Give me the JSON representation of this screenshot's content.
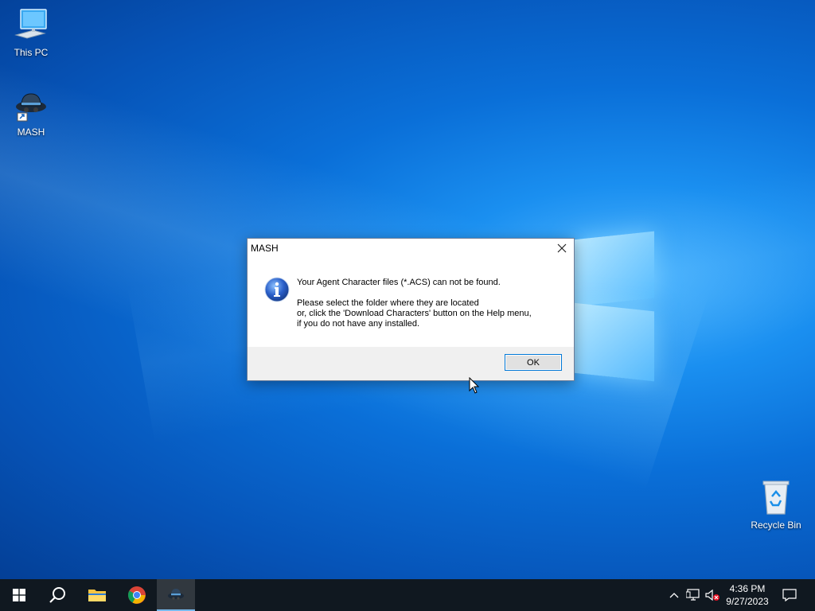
{
  "desktop": {
    "icons": [
      {
        "label": "This PC",
        "icon": "computer-icon"
      },
      {
        "label": "MASH",
        "icon": "mash-agent-icon",
        "shortcut": true
      },
      {
        "label": "Recycle Bin",
        "icon": "recycle-bin-icon"
      }
    ]
  },
  "dialog": {
    "title": "MASH",
    "icon": "info-icon",
    "message_line1": "Your Agent Character files (*.ACS) can not be found.",
    "message_line2": "Please select the folder where they are located",
    "message_line3": "or, click the 'Download Characters' button on the Help menu,",
    "message_line4": "if you do not have any installed.",
    "ok_label": "OK"
  },
  "taskbar": {
    "items": [
      {
        "name": "start",
        "icon": "windows-logo-icon"
      },
      {
        "name": "search",
        "icon": "search-icon"
      },
      {
        "name": "file-explorer",
        "icon": "folder-icon"
      },
      {
        "name": "chrome",
        "icon": "chrome-icon"
      },
      {
        "name": "mash",
        "icon": "mash-agent-icon",
        "active": true
      }
    ],
    "tray": {
      "icons": [
        "chevron-up-icon",
        "network-icon",
        "volume-muted-icon",
        "notification-icon"
      ],
      "time": "4:36 PM",
      "date": "9/27/2023"
    }
  },
  "colors": {
    "desktop_blue": "#0a6fd8",
    "taskbar": "#101820",
    "ok_border": "#0078d7"
  }
}
